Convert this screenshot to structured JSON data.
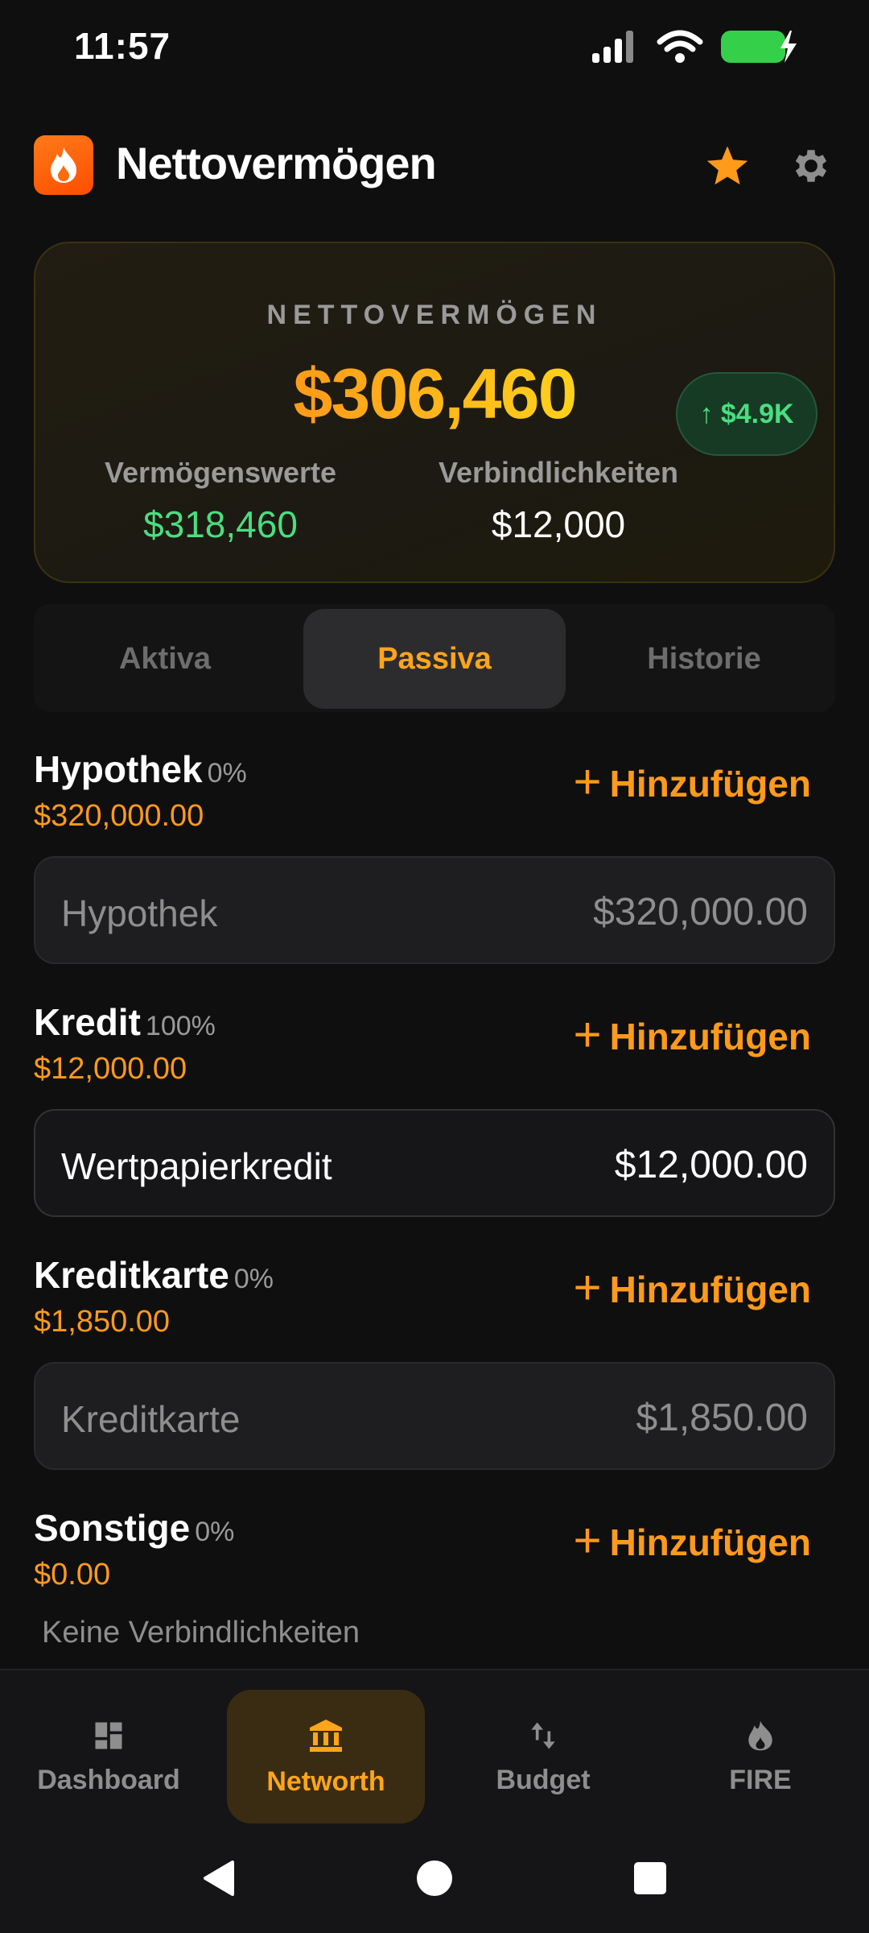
{
  "status": {
    "time": "11:57"
  },
  "header": {
    "title": "Nettovermögen"
  },
  "summary": {
    "label": "NETTOVERMÖGEN",
    "net_worth": "$306,460",
    "change": "↑ $4.9K",
    "assets_label": "Vermögenswerte",
    "assets_value": "$318,460",
    "liabilities_label": "Verbindlichkeiten",
    "liabilities_value": "$12,000"
  },
  "tabs": [
    {
      "label": "Aktiva"
    },
    {
      "label": "Passiva"
    },
    {
      "label": "Historie"
    }
  ],
  "add_label": "Hinzufügen",
  "sections": [
    {
      "title": "Hypothek",
      "pct": "0%",
      "total": "$320,000.00",
      "items": [
        {
          "name": "Hypothek",
          "amount": "$320,000.00"
        }
      ]
    },
    {
      "title": "Kredit",
      "pct": "100%",
      "total": "$12,000.00",
      "items": [
        {
          "name": "Wertpapierkredit",
          "amount": "$12,000.00"
        }
      ]
    },
    {
      "title": "Kreditkarte",
      "pct": "0%",
      "total": "$1,850.00",
      "items": [
        {
          "name": "Kreditkarte",
          "amount": "$1,850.00"
        }
      ]
    },
    {
      "title": "Sonstige",
      "pct": "0%",
      "total": "$0.00",
      "empty_text": "Keine Verbindlichkeiten"
    }
  ],
  "nav": [
    {
      "label": "Dashboard",
      "icon": "dashboard-icon"
    },
    {
      "label": "Networth",
      "icon": "bank-icon"
    },
    {
      "label": "Budget",
      "icon": "transfer-icon"
    },
    {
      "label": "FIRE",
      "icon": "fire-icon"
    }
  ],
  "colors": {
    "accent": "#ff9a1a",
    "positive": "#4ade80",
    "background": "#0f0f10"
  }
}
